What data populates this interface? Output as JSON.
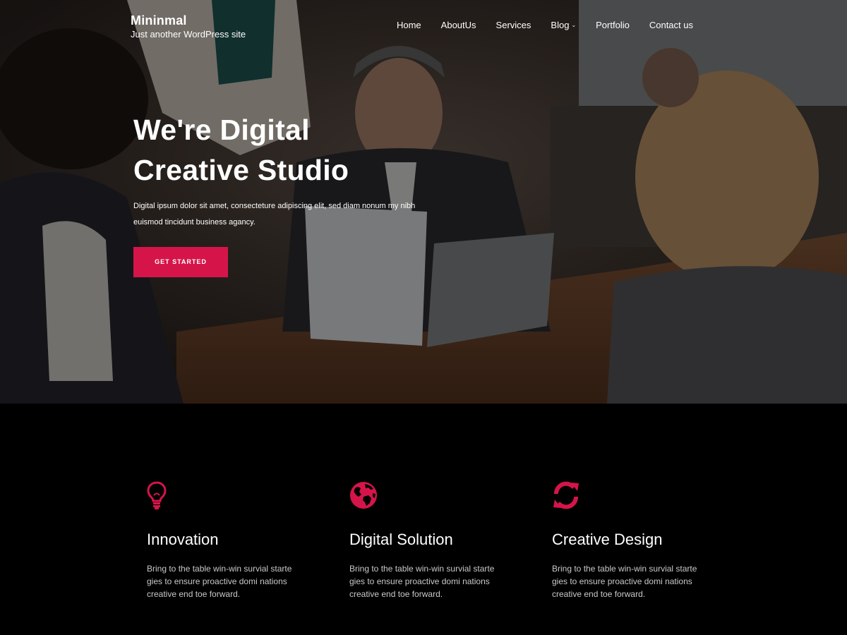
{
  "site": {
    "title": "Mininmal",
    "tagline": "Just another WordPress site"
  },
  "nav": {
    "items": [
      {
        "label": "Home"
      },
      {
        "label": "AboutUs"
      },
      {
        "label": "Services"
      },
      {
        "label": "Blog",
        "has_dropdown": true
      },
      {
        "label": "Portfolio"
      },
      {
        "label": "Contact us"
      }
    ]
  },
  "hero": {
    "heading_line1": "We're Digital",
    "heading_line2": "Creative Studio",
    "text": "Digital ipsum dolor sit amet, consecteture adipiscing elit, sed diam nonum my nibh euismod tincidunt business agancy.",
    "cta_label": "GET STARTED"
  },
  "features": [
    {
      "icon": "lightbulb-icon",
      "title": "Innovation",
      "text": "Bring to the table win-win survial starte gies to ensure proactive domi nations creative end toe forward."
    },
    {
      "icon": "globe-icon",
      "title": "Digital Solution",
      "text": "Bring to the table win-win survial starte gies to ensure proactive domi nations creative end toe forward."
    },
    {
      "icon": "refresh-icon",
      "title": "Creative Design",
      "text": "Bring to the table win-win survial starte gies to ensure proactive domi nations creative end toe forward."
    }
  ],
  "colors": {
    "accent": "#d5154a",
    "background": "#000000",
    "text": "#ffffff",
    "muted_text": "#c9c9c9"
  }
}
